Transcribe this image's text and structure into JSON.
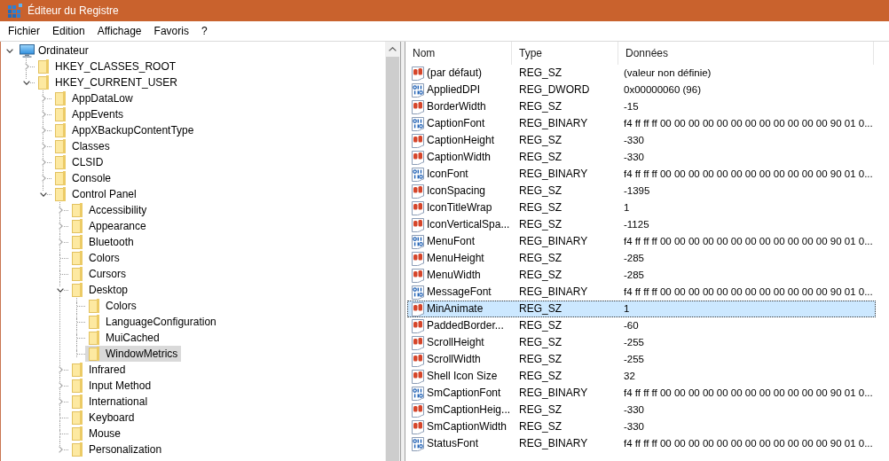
{
  "window": {
    "title": "Éditeur du Registre"
  },
  "menu": [
    "Fichier",
    "Edition",
    "Affichage",
    "Favoris",
    "?"
  ],
  "tree": {
    "nodes": [
      {
        "label": "Ordinateur",
        "kind": "computer",
        "expanded": true,
        "selected": false,
        "children": [
          {
            "label": "HKEY_CLASSES_ROOT",
            "kind": "folder",
            "expanded": false,
            "selected": false
          },
          {
            "label": "HKEY_CURRENT_USER",
            "kind": "folder",
            "expanded": true,
            "selected": false,
            "children": [
              {
                "label": "AppDataLow",
                "kind": "folder",
                "expanded": false,
                "selected": false
              },
              {
                "label": "AppEvents",
                "kind": "folder",
                "expanded": false,
                "selected": false
              },
              {
                "label": "AppXBackupContentType",
                "kind": "folder",
                "expanded": false,
                "selected": false
              },
              {
                "label": "Classes",
                "kind": "folder",
                "expanded": false,
                "selected": false
              },
              {
                "label": "CLSID",
                "kind": "folder",
                "expanded": false,
                "selected": false
              },
              {
                "label": "Console",
                "kind": "folder",
                "expanded": false,
                "selected": false
              },
              {
                "label": "Control Panel",
                "kind": "folder",
                "expanded": true,
                "selected": false,
                "children": [
                  {
                    "label": "Accessibility",
                    "kind": "folder",
                    "expanded": false,
                    "selected": false
                  },
                  {
                    "label": "Appearance",
                    "kind": "folder",
                    "expanded": false,
                    "selected": false
                  },
                  {
                    "label": "Bluetooth",
                    "kind": "folder",
                    "expanded": false,
                    "selected": false
                  },
                  {
                    "label": "Colors",
                    "kind": "folder",
                    "selected": false
                  },
                  {
                    "label": "Cursors",
                    "kind": "folder",
                    "selected": false
                  },
                  {
                    "label": "Desktop",
                    "kind": "folder",
                    "expanded": true,
                    "selected": false,
                    "children": [
                      {
                        "label": "Colors",
                        "kind": "folder",
                        "selected": false
                      },
                      {
                        "label": "LanguageConfiguration",
                        "kind": "folder",
                        "selected": false
                      },
                      {
                        "label": "MuiCached",
                        "kind": "folder",
                        "selected": false
                      },
                      {
                        "label": "WindowMetrics",
                        "kind": "folder",
                        "selected": true
                      }
                    ]
                  },
                  {
                    "label": "Infrared",
                    "kind": "folder",
                    "expanded": false,
                    "selected": false
                  },
                  {
                    "label": "Input Method",
                    "kind": "folder",
                    "expanded": false,
                    "selected": false
                  },
                  {
                    "label": "International",
                    "kind": "folder",
                    "expanded": false,
                    "selected": false
                  },
                  {
                    "label": "Keyboard",
                    "kind": "folder",
                    "selected": false
                  },
                  {
                    "label": "Mouse",
                    "kind": "folder",
                    "selected": false
                  },
                  {
                    "label": "Personalization",
                    "kind": "folder",
                    "expanded": false,
                    "selected": false
                  }
                ]
              }
            ]
          }
        ]
      }
    ]
  },
  "values": {
    "columns": [
      "Nom",
      "Type",
      "Données"
    ],
    "rows": [
      {
        "kind": "string",
        "name": "(par défaut)",
        "type": "REG_SZ",
        "data": "(valeur non définie)",
        "selected": false
      },
      {
        "kind": "binary",
        "name": "AppliedDPI",
        "type": "REG_DWORD",
        "data": "0x00000060 (96)",
        "selected": false
      },
      {
        "kind": "string",
        "name": "BorderWidth",
        "type": "REG_SZ",
        "data": "-15",
        "selected": false
      },
      {
        "kind": "binary",
        "name": "CaptionFont",
        "type": "REG_BINARY",
        "data": "f4 ff ff ff 00 00 00 00 00 00 00 00 00 00 00 00 90 01 0...",
        "selected": false
      },
      {
        "kind": "string",
        "name": "CaptionHeight",
        "type": "REG_SZ",
        "data": "-330",
        "selected": false
      },
      {
        "kind": "string",
        "name": "CaptionWidth",
        "type": "REG_SZ",
        "data": "-330",
        "selected": false
      },
      {
        "kind": "binary",
        "name": "IconFont",
        "type": "REG_BINARY",
        "data": "f4 ff ff ff 00 00 00 00 00 00 00 00 00 00 00 00 90 01 0...",
        "selected": false
      },
      {
        "kind": "string",
        "name": "IconSpacing",
        "type": "REG_SZ",
        "data": "-1395",
        "selected": false
      },
      {
        "kind": "string",
        "name": "IconTitleWrap",
        "type": "REG_SZ",
        "data": "1",
        "selected": false
      },
      {
        "kind": "string",
        "name": "IconVerticalSpa...",
        "type": "REG_SZ",
        "data": "-1125",
        "selected": false
      },
      {
        "kind": "binary",
        "name": "MenuFont",
        "type": "REG_BINARY",
        "data": "f4 ff ff ff 00 00 00 00 00 00 00 00 00 00 00 00 90 01 0...",
        "selected": false
      },
      {
        "kind": "string",
        "name": "MenuHeight",
        "type": "REG_SZ",
        "data": "-285",
        "selected": false
      },
      {
        "kind": "string",
        "name": "MenuWidth",
        "type": "REG_SZ",
        "data": "-285",
        "selected": false
      },
      {
        "kind": "binary",
        "name": "MessageFont",
        "type": "REG_BINARY",
        "data": "f4 ff ff ff 00 00 00 00 00 00 00 00 00 00 00 00 90 01 0...",
        "selected": false
      },
      {
        "kind": "string",
        "name": "MinAnimate",
        "type": "REG_SZ",
        "data": "1",
        "selected": true
      },
      {
        "kind": "string",
        "name": "PaddedBorder...",
        "type": "REG_SZ",
        "data": "-60",
        "selected": false
      },
      {
        "kind": "string",
        "name": "ScrollHeight",
        "type": "REG_SZ",
        "data": "-255",
        "selected": false
      },
      {
        "kind": "string",
        "name": "ScrollWidth",
        "type": "REG_SZ",
        "data": "-255",
        "selected": false
      },
      {
        "kind": "string",
        "name": "Shell Icon Size",
        "type": "REG_SZ",
        "data": "32",
        "selected": false
      },
      {
        "kind": "binary",
        "name": "SmCaptionFont",
        "type": "REG_BINARY",
        "data": "f4 ff ff ff 00 00 00 00 00 00 00 00 00 00 00 00 90 01 0...",
        "selected": false
      },
      {
        "kind": "string",
        "name": "SmCaptionHeig...",
        "type": "REG_SZ",
        "data": "-330",
        "selected": false
      },
      {
        "kind": "string",
        "name": "SmCaptionWidth",
        "type": "REG_SZ",
        "data": "-330",
        "selected": false
      },
      {
        "kind": "binary",
        "name": "StatusFont",
        "type": "REG_BINARY",
        "data": "f4 ff ff ff 00 00 00 00 00 00 00 00 00 00 00 00 90 01 0...",
        "selected": false
      }
    ]
  }
}
